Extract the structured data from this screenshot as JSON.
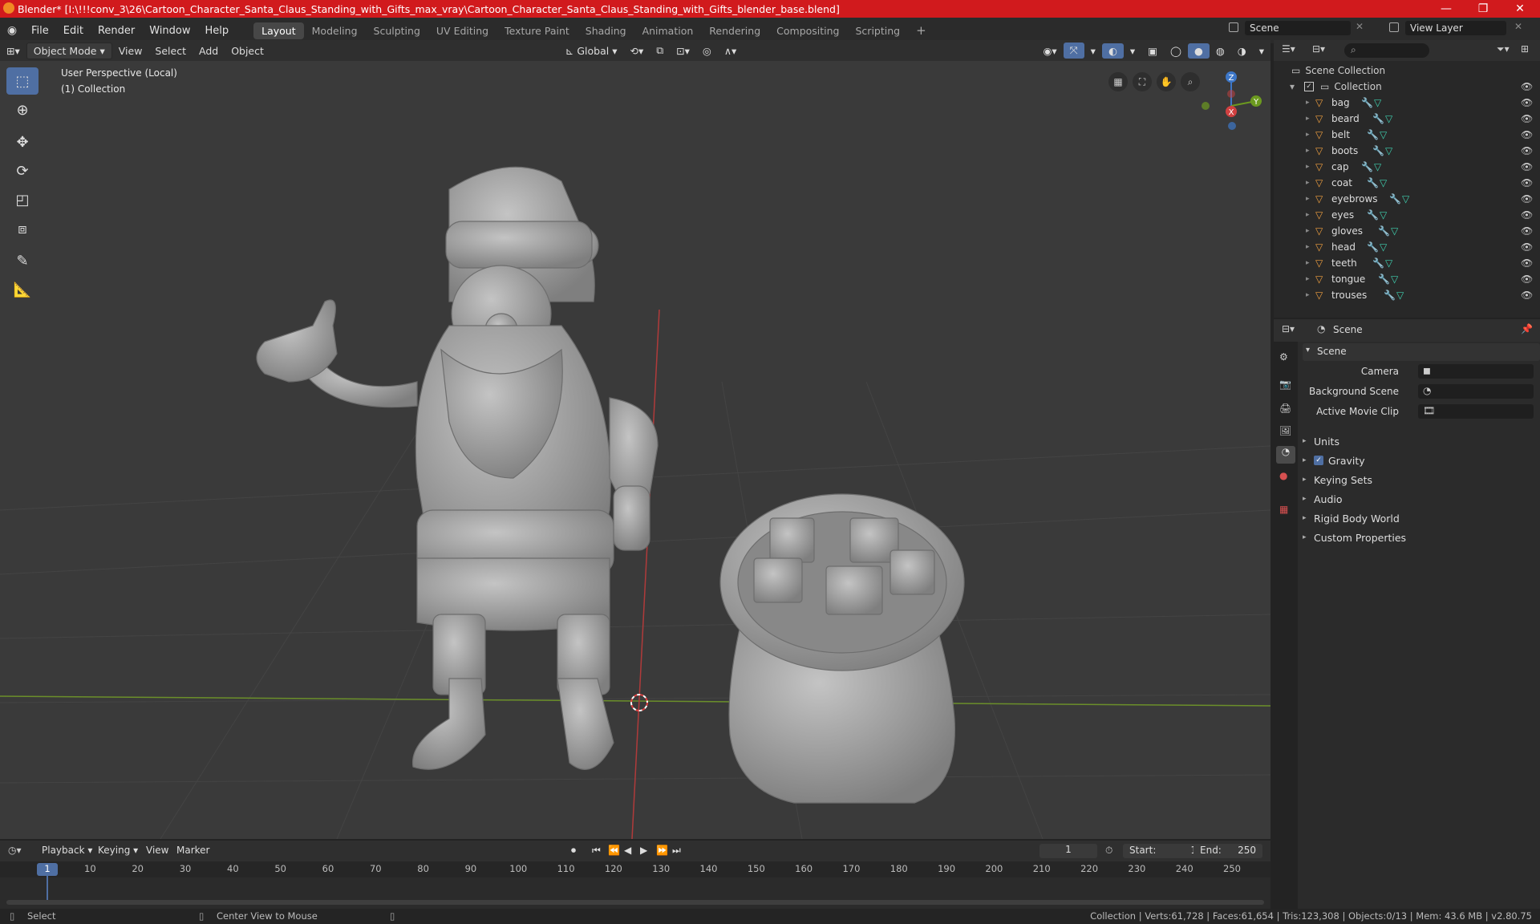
{
  "titlebar": {
    "text": "Blender* [I:\\!!!conv_3\\26\\Cartoon_Character_Santa_Claus_Standing_with_Gifts_max_vray\\Cartoon_Character_Santa_Claus_Standing_with_Gifts_blender_base.blend]",
    "min": "—",
    "max": "❐",
    "close": "✕"
  },
  "menus": [
    "File",
    "Edit",
    "Render",
    "Window",
    "Help"
  ],
  "workspaces": [
    "Layout",
    "Modeling",
    "Sculpting",
    "UV Editing",
    "Texture Paint",
    "Shading",
    "Animation",
    "Rendering",
    "Compositing",
    "Scripting"
  ],
  "scene_field": "Scene",
  "view_layer_field": "View Layer",
  "viewport_header": {
    "mode": "Object Mode",
    "view": "View",
    "select": "Select",
    "add": "Add",
    "object": "Object",
    "transform": "Global"
  },
  "viewport": {
    "perspective": "User Perspective (Local)",
    "collection": "(1) Collection",
    "axis_x": "X",
    "axis_y": "Y",
    "axis_z": "Z"
  },
  "outliner": {
    "scene_collection": "Scene Collection",
    "collection": "Collection",
    "objects": [
      "bag",
      "beard",
      "belt",
      "boots",
      "cap",
      "coat",
      "eyebrows",
      "eyes",
      "gloves",
      "head",
      "teeth",
      "tongue",
      "trouses"
    ]
  },
  "properties": {
    "header": "Scene",
    "panel": "Scene",
    "camera": "Camera",
    "background_scene": "Background Scene",
    "active_movie_clip": "Active Movie Clip",
    "sections": [
      "Units",
      "Gravity",
      "Keying Sets",
      "Audio",
      "Rigid Body World",
      "Custom Properties"
    ]
  },
  "timeline": {
    "playback": "Playback",
    "keying": "Keying",
    "view": "View",
    "marker": "Marker",
    "current_frame": "1",
    "start_label": "Start:",
    "start": "1",
    "end_label": "End:",
    "end": "250",
    "ticks": [
      "1",
      "10",
      "20",
      "30",
      "40",
      "50",
      "60",
      "70",
      "80",
      "90",
      "100",
      "110",
      "120",
      "130",
      "140",
      "150",
      "160",
      "170",
      "180",
      "190",
      "200",
      "210",
      "220",
      "230",
      "240",
      "250"
    ]
  },
  "status": {
    "select": "Select",
    "center_view": "Center View to Mouse",
    "stats": "Collection | Verts:61,728 | Faces:61,654 | Tris:123,308 | Objects:0/13 | Mem: 43.6 MB | v2.80.75"
  },
  "colors": {
    "titlebar": "#d11a1d",
    "accent": "#4f6fa3",
    "mesh": "#9a9a9a"
  }
}
